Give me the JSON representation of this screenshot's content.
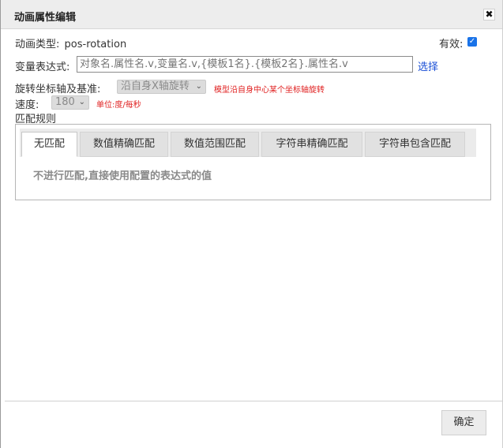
{
  "dialog": {
    "title": "动画属性编辑",
    "close_glyph": "✖"
  },
  "animation_type": {
    "label": "动画类型:",
    "value": "pos-rotation"
  },
  "valid": {
    "label": "有效:",
    "checked": true,
    "check_glyph": "✓"
  },
  "expression": {
    "label": "变量表达式:",
    "placeholder": "对象名.属性名.v,变量名.v,{模板1名}.{模板2名}.属性名.v",
    "value": "",
    "select_link": "选择"
  },
  "rotation_axis": {
    "label": "旋转坐标轴及基准:",
    "selected": "沿自身X轴旋转",
    "hint": "模型沿自身中心某个坐标轴旋转"
  },
  "speed": {
    "label": "速度:",
    "selected": "180",
    "hint": "单位:度/每秒"
  },
  "match_rules": {
    "label": "匹配规则",
    "tabs": [
      {
        "label": "无匹配",
        "active": true
      },
      {
        "label": "数值精确匹配",
        "active": false
      },
      {
        "label": "数值范围匹配",
        "active": false
      },
      {
        "label": "字符串精确匹配",
        "active": false
      },
      {
        "label": "字符串包含匹配",
        "active": false
      }
    ],
    "description": "不进行匹配,直接使用配置的表达式的值"
  },
  "footer": {
    "ok_label": "确定"
  },
  "icons": {
    "close": "close-icon",
    "caret": "chevron-down-icon",
    "check": "check-icon"
  },
  "colors": {
    "link": "#1a4fd6",
    "hint": "#e02020",
    "checkbox": "#1a73e8"
  }
}
